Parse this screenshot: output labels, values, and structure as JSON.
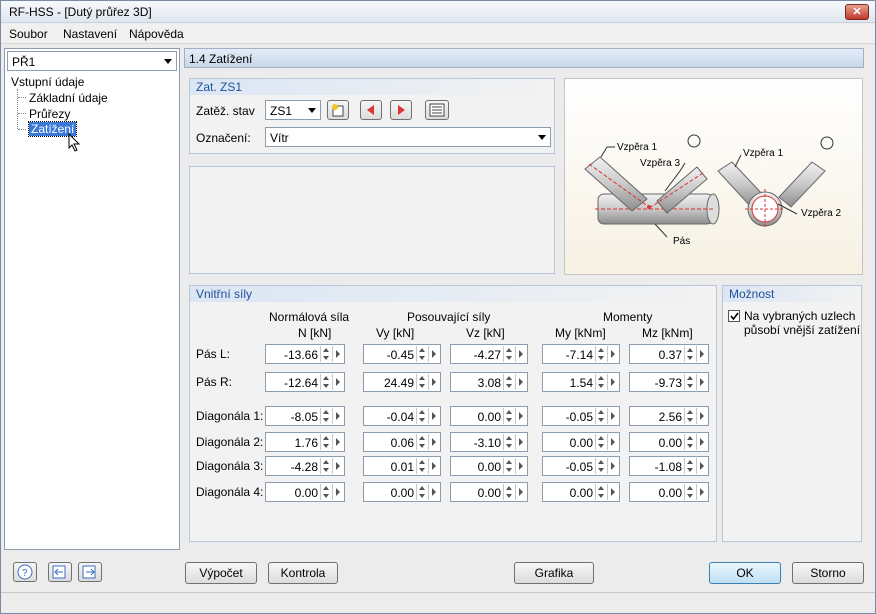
{
  "window": {
    "title": "RF-HSS - [Dutý průřez 3D]",
    "close_label": "✕"
  },
  "menu": {
    "items": [
      "Soubor",
      "Nastavení",
      "Nápověda"
    ]
  },
  "left": {
    "case_select": "PŘ1",
    "tree": {
      "root": "Vstupní údaje",
      "items": [
        "Základní údaje",
        "Průřezy",
        "Zatížení"
      ]
    }
  },
  "header": {
    "title": "1.4 Zatížení"
  },
  "load_case_group": {
    "title": "Zat. ZS1",
    "stav_label": "Zatěž. stav",
    "stav_value": "ZS1",
    "oznaceni_label": "Označení:",
    "oznaceni_value": "Vítr"
  },
  "preview": {
    "labels": [
      "Vzpěra 1",
      "Vzpěra 3",
      "Pás",
      "Vzpěra 1",
      "Vzpěra 2"
    ]
  },
  "internal_forces": {
    "title": "Vnitřní síly",
    "group_headers": {
      "normal": "Normálová síla",
      "shear": "Posouvající síly",
      "moments": "Momenty"
    },
    "columns": [
      {
        "label": "N  [kN]"
      },
      {
        "label": "Vy  [kN]"
      },
      {
        "label": "Vz  [kN]"
      },
      {
        "label": "My  [kNm]"
      },
      {
        "label": "Mz  [kNm]"
      }
    ],
    "rows": [
      {
        "label": "Pás L:",
        "values": [
          "-13.66",
          "-0.45",
          "-4.27",
          "-7.14",
          "0.37"
        ]
      },
      {
        "label": "Pás R:",
        "values": [
          "-12.64",
          "24.49",
          "3.08",
          "1.54",
          "-9.73"
        ]
      },
      {
        "label": "Diagonála 1:",
        "values": [
          "-8.05",
          "-0.04",
          "0.00",
          "-0.05",
          "2.56"
        ]
      },
      {
        "label": "Diagonála 2:",
        "values": [
          "1.76",
          "0.06",
          "-3.10",
          "0.00",
          "0.00"
        ]
      },
      {
        "label": "Diagonála 3:",
        "values": [
          "-4.28",
          "0.01",
          "0.00",
          "-0.05",
          "-1.08"
        ]
      },
      {
        "label": "Diagonála 4:",
        "values": [
          "0.00",
          "0.00",
          "0.00",
          "0.00",
          "0.00"
        ]
      }
    ]
  },
  "options": {
    "title": "Možnost",
    "checkbox_label_1": "Na vybraných uzlech",
    "checkbox_label_2": "působí vnější zatížení",
    "checked": true
  },
  "buttons": {
    "vypocet": "Výpočet",
    "kontrola": "Kontrola",
    "grafika": "Grafika",
    "ok": "OK",
    "storno": "Storno"
  }
}
